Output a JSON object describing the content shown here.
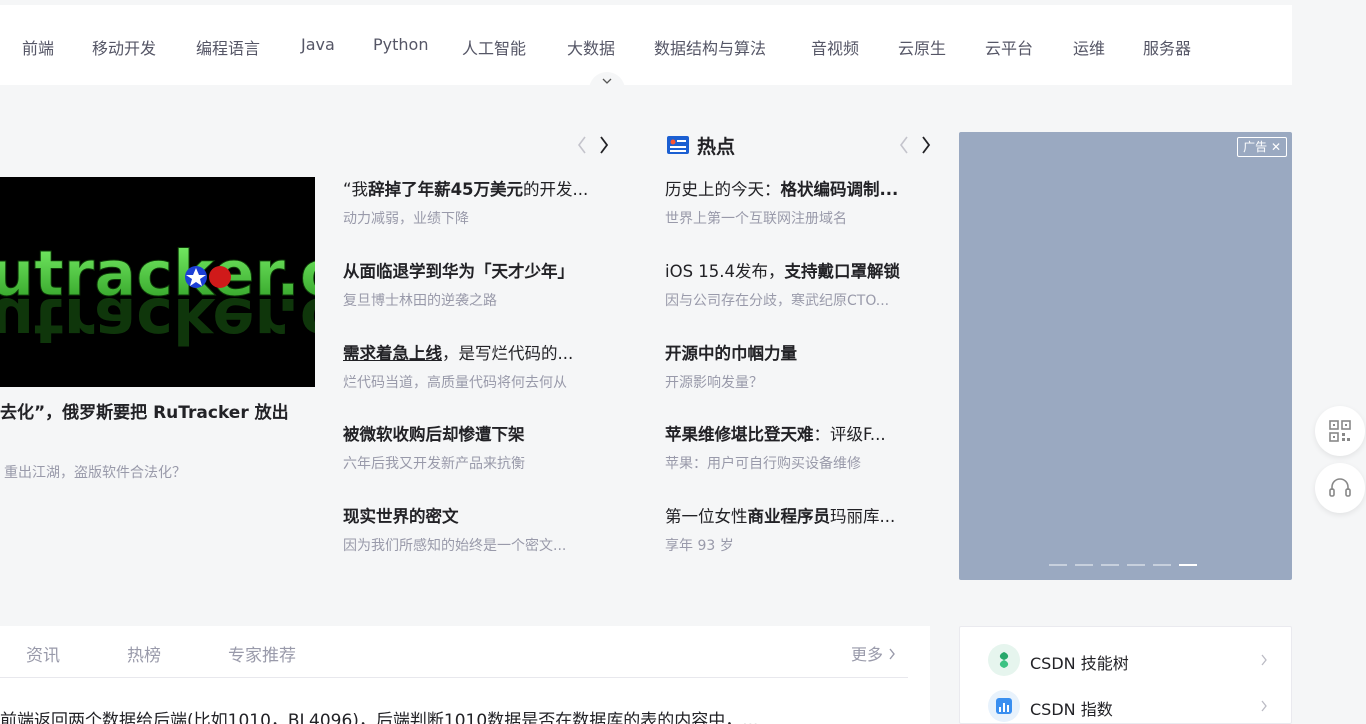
{
  "nav": {
    "categories": [
      "前端",
      "移动开发",
      "编程语言",
      "Java",
      "Python",
      "人工智能",
      "大数据",
      "数据结构与算法",
      "音视频",
      "云原生",
      "云平台",
      "运维",
      "服务器"
    ]
  },
  "hot": {
    "title": "热点",
    "featured": {
      "image_text": "utracker.org",
      "title": "去化”，俄罗斯要把 RuTracker 放出",
      "desc": "重出江湖，盗版软件合法化？"
    },
    "col1": [
      {
        "pre": "“我",
        "bold": "辞掉了年薪45万美元",
        "post": "的开发...",
        "desc": "动力减弱，业绩下降"
      },
      {
        "pre": "",
        "bold": "从面临退学到华为「天才少年」",
        "post": "",
        "desc": "复旦博士林田的逆袭之路"
      },
      {
        "pre": "",
        "bold": "需求着急上线",
        "post": "，是写烂代码的...",
        "desc": "烂代码当道，高质量代码将何去何从"
      },
      {
        "pre": "",
        "bold": "被微软收购后却惨遭下架",
        "post": "",
        "desc": "六年后我又开发新产品来抗衡"
      },
      {
        "pre": "",
        "bold": "现实世界的密文",
        "post": "",
        "desc": "因为我们所感知的始终是一个密文..."
      }
    ],
    "col2": [
      {
        "pre": "历史上的今天：",
        "bold": "格状编码调制...",
        "post": "",
        "desc": "世界上第一个互联网注册域名"
      },
      {
        "pre": "iOS 15.4发布，",
        "bold": "支持戴口罩解锁",
        "post": "",
        "desc": "因与公司存在分歧，寒武纪原CTO..."
      },
      {
        "pre": "",
        "bold": "开源中的巾帼力量",
        "post": "",
        "desc": "开源影响发量？"
      },
      {
        "pre": "",
        "bold": "苹果维修堪比登天难",
        "post": "：评级F...",
        "desc": "苹果：用户可自行购买设备维修"
      },
      {
        "pre": "第一位女性",
        "bold": "商业程序员",
        "post": "玛丽库...",
        "desc": "享年 93 岁"
      }
    ]
  },
  "ad": {
    "tag": "广告 ✕",
    "slides": 6,
    "active_slide": 6
  },
  "list": {
    "tabs": [
      "资讯",
      "热榜",
      "专家推荐"
    ],
    "more": "更多",
    "first_row": "前端返回两个数据给后端(比如1010，BL4096)，后端判断1010数据是否在数据库的表的内容中，..."
  },
  "card": {
    "items": [
      {
        "label": "CSDN 技能树",
        "icon": "skill-tree-icon",
        "color": "#e6f5ee"
      },
      {
        "label": "CSDN 指数",
        "icon": "index-chart-icon",
        "color": "#e8f2fc"
      }
    ]
  },
  "side_buttons": [
    {
      "icon": "qr-code-icon"
    },
    {
      "icon": "headset-icon"
    }
  ]
}
